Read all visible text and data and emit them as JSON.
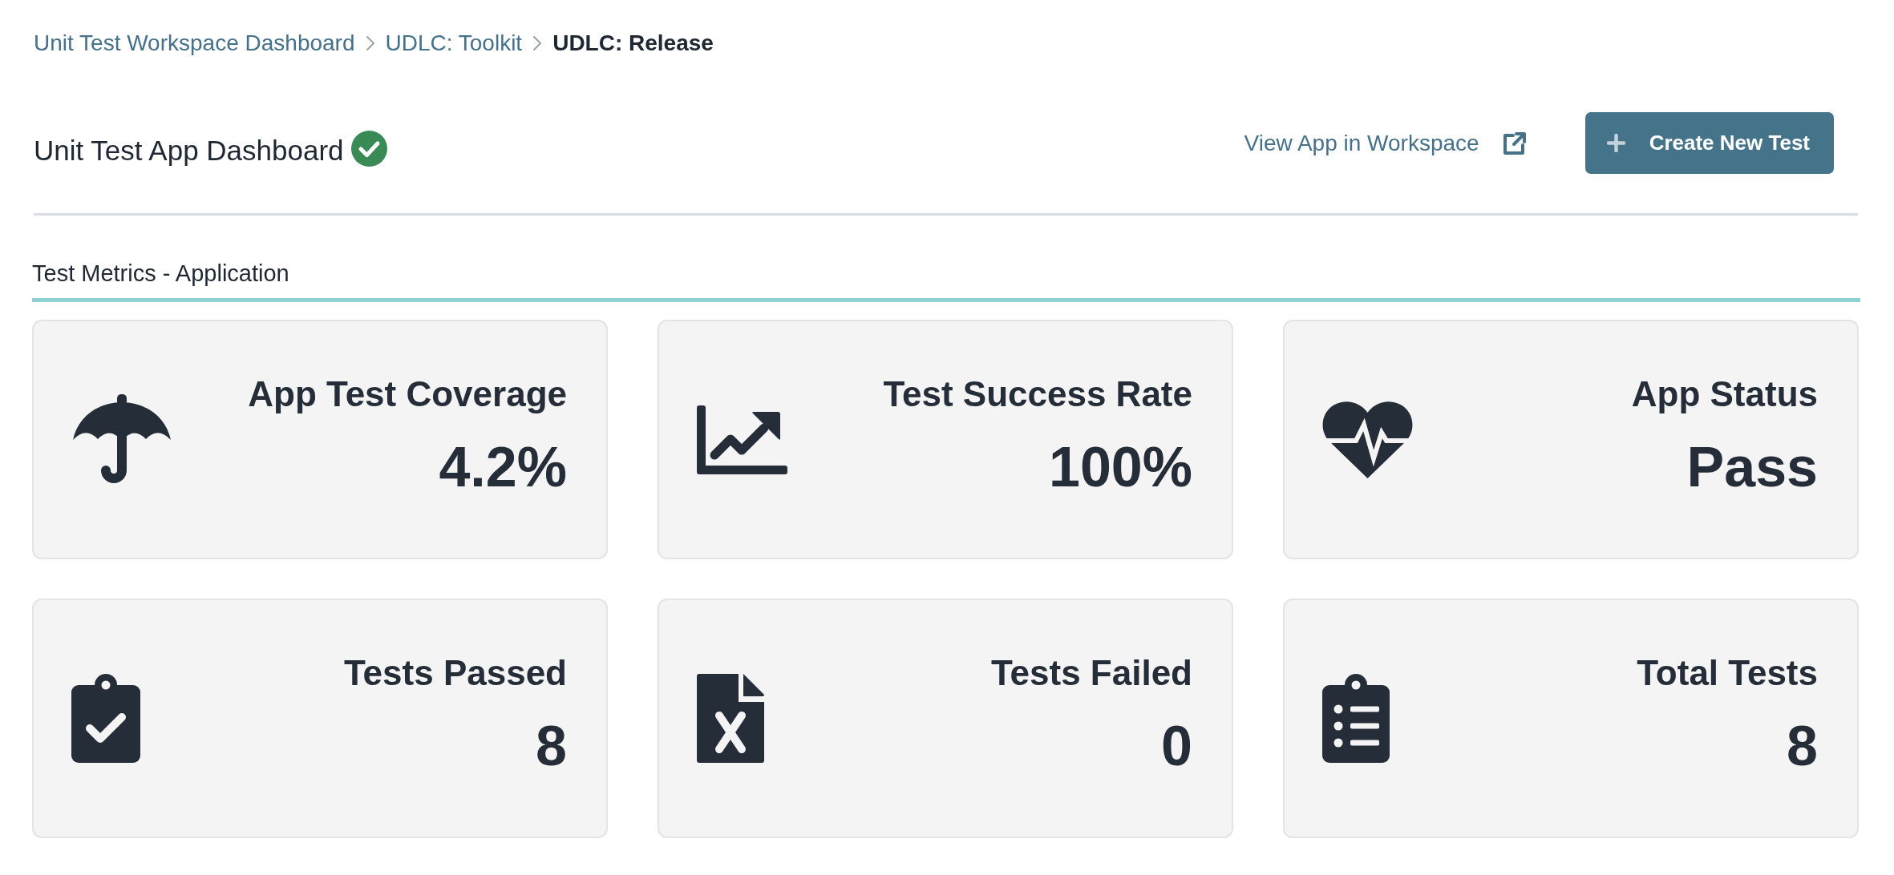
{
  "breadcrumb": [
    {
      "label": "Unit Test Workspace Dashboard",
      "current": false
    },
    {
      "label": "UDLC: Toolkit",
      "current": false
    },
    {
      "label": "UDLC: Release",
      "current": true
    }
  ],
  "header": {
    "title": "Unit Test App Dashboard",
    "verified": true,
    "link": "View App in Workspace",
    "button": "Create New Test"
  },
  "section": {
    "title": "Test Metrics - Application"
  },
  "metrics": [
    {
      "label": "App Test Coverage",
      "value": "4.2%"
    },
    {
      "label": "Test Success Rate",
      "value": "100%"
    },
    {
      "label": "App Status",
      "value": "Pass"
    },
    {
      "label": "Tests Passed",
      "value": "8"
    },
    {
      "label": "Tests Failed",
      "value": "0"
    },
    {
      "label": "Total Tests",
      "value": "8"
    }
  ]
}
